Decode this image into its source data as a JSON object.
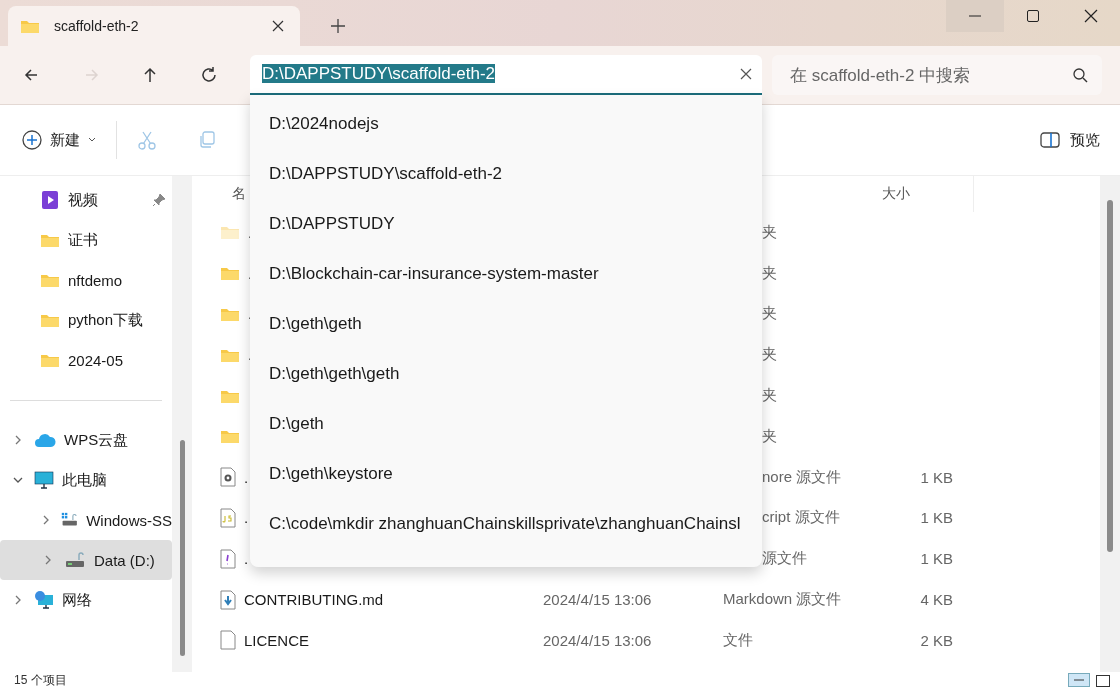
{
  "tab": {
    "title": "scaffold-eth-2",
    "selected": true
  },
  "nav": [
    {
      "kind": "back",
      "disabled": false
    },
    {
      "kind": "forward",
      "disabled": true
    },
    {
      "kind": "up",
      "disabled": false
    },
    {
      "kind": "refresh",
      "disabled": false
    }
  ],
  "address": {
    "value": "D:\\DAPPSTUDY\\scaffold-eth-2",
    "selected_text": true
  },
  "search": {
    "placeholder": "在 scaffold-eth-2 中搜索"
  },
  "commands": {
    "new_label": "新建",
    "actions": [
      {
        "kind": "cut",
        "disabled": true
      },
      {
        "kind": "copy",
        "disabled": true
      }
    ],
    "preview_label": "预览"
  },
  "sidebar": {
    "quick": [
      {
        "label": "视频",
        "kind": "video",
        "pinned": true
      },
      {
        "label": "证书",
        "kind": "folder",
        "pinned": false
      },
      {
        "label": "nftdemo",
        "kind": "folder",
        "pinned": false
      },
      {
        "label": "python下载",
        "kind": "folder",
        "pinned": false
      },
      {
        "label": "2024-05",
        "kind": "folder",
        "pinned": false
      }
    ],
    "tree": [
      {
        "label": "WPS云盘",
        "kind": "cloud",
        "expanded": false,
        "selected": false
      },
      {
        "label": "此电脑",
        "kind": "pc",
        "expanded": true,
        "selected": false,
        "children": [
          {
            "label": "Windows-SS",
            "kind": "windrive",
            "expanded": false,
            "selected": false
          },
          {
            "label": "Data (D:)",
            "kind": "drive",
            "expanded": false,
            "selected": true
          }
        ]
      },
      {
        "label": "网络",
        "kind": "network",
        "expanded": false,
        "selected": false
      }
    ]
  },
  "table": {
    "columns": [
      {
        "label": "名"
      },
      {
        "label": "大小"
      }
    ],
    "rows": [
      {
        "kind": "hidden-folder",
        "name": ".",
        "type": "夹"
      },
      {
        "kind": "folder",
        "name": ".",
        "type": "夹"
      },
      {
        "kind": "folder",
        "name": ".",
        "type": "夹"
      },
      {
        "kind": "folder",
        "name": ".",
        "type": "夹"
      },
      {
        "kind": "folder",
        "type": "夹"
      },
      {
        "kind": "folder",
        "type": "夹"
      },
      {
        "kind": "config",
        "name": ".",
        "type": "nore 源文件",
        "size": "1 KB"
      },
      {
        "kind": "js",
        "name": ".",
        "type": "cript 源文件",
        "size": "1 KB"
      },
      {
        "kind": "warn",
        "name": ".",
        "type": "源文件",
        "size": "1 KB"
      },
      {
        "kind": "md",
        "name": "CONTRIBUTING.md",
        "date": "2024/4/15 13:06",
        "type": "Markdown 源文件",
        "size": "4 KB"
      },
      {
        "kind": "file",
        "name": "LICENCE",
        "date": "2024/4/15 13:06",
        "type": "文件",
        "size": "2 KB"
      }
    ]
  },
  "dropdown": {
    "items": [
      {
        "label": "D:\\2024nodejs"
      },
      {
        "label": "D:\\DAPPSTUDY\\scaffold-eth-2"
      },
      {
        "label": "D:\\DAPPSTUDY"
      },
      {
        "label": "D:\\Blockchain-car-insurance-system-master"
      },
      {
        "label": "D:\\geth\\geth"
      },
      {
        "label": "D:\\geth\\geth\\geth"
      },
      {
        "label": "D:\\geth"
      },
      {
        "label": "D:\\geth\\keystore"
      },
      {
        "label": "C:\\code\\mkdir zhanghuanChainskillsprivate\\zhanghuanChainsl"
      }
    ]
  },
  "status_bar": {
    "count": "15 个项目"
  }
}
